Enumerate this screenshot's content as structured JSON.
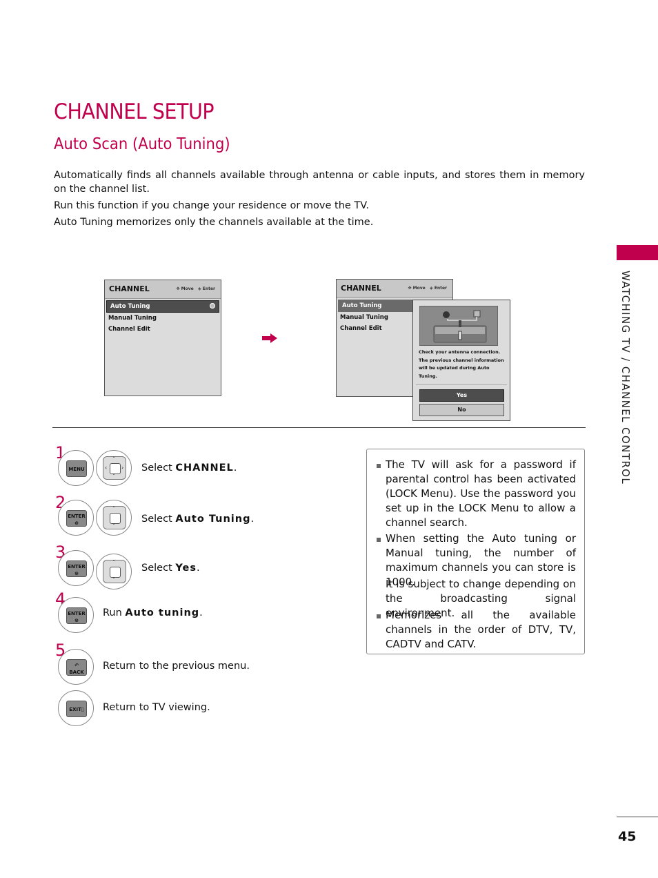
{
  "page": {
    "title": "CHANNEL SETUP",
    "subtitle": "Auto Scan (Auto Tuning)",
    "intro": [
      "Automatically finds all channels available through antenna or cable inputs, and stores them in memory on the channel list.",
      "Run this function if you change your residence or move the TV.",
      "Auto Tuning memorizes only the channels available at the time."
    ],
    "side_label": "WATCHING TV / CHANNEL CONTROL",
    "page_number": "45",
    "accent_color": "#c0004c"
  },
  "osd_left": {
    "title": "CHANNEL",
    "hint_move": "Move",
    "hint_enter": "Enter",
    "items": [
      "Auto Tuning",
      "Manual Tuning",
      "Channel Edit"
    ],
    "selected_index": 0
  },
  "osd_right": {
    "title": "CHANNEL",
    "hint_move": "Move",
    "hint_enter": "Enter",
    "items": [
      "Auto Tuning",
      "Manual Tuning",
      "Channel Edit"
    ],
    "selected_index": 0,
    "popup": {
      "message": "Check your antenna connection. The previous channel information will be updated during Auto Tuning.",
      "yes_label": "Yes",
      "no_label": "No"
    }
  },
  "steps": [
    {
      "num": "1",
      "keys": [
        "MENU",
        "dpad-4way"
      ],
      "prefix": "Select ",
      "bold": "CHANNEL",
      "suffix": "."
    },
    {
      "num": "2",
      "keys": [
        "ENTER",
        "dpad-updown"
      ],
      "prefix": "Select ",
      "bold": "Auto Tuning",
      "suffix": "."
    },
    {
      "num": "3",
      "keys": [
        "ENTER",
        "dpad-updown"
      ],
      "prefix": "Select ",
      "bold": "Yes",
      "suffix": "."
    },
    {
      "num": "4",
      "keys": [
        "ENTER"
      ],
      "prefix": "Run ",
      "bold": "Auto tuning",
      "suffix": "."
    },
    {
      "num": "5",
      "keys": [
        "BACK"
      ],
      "text": "Return to the previous menu."
    },
    {
      "num": "",
      "keys": [
        "EXIT"
      ],
      "text": "Return to TV viewing."
    }
  ],
  "key_labels": {
    "menu": "MENU",
    "enter": "ENTER",
    "back": "BACK",
    "exit": "EXIT"
  },
  "notes": [
    "The TV will ask for a password if parental control has been activated (LOCK Menu). Use the password you set up in the LOCK Menu to allow a channel search.",
    "When setting the Auto tuning or Manual tuning, the number of maximum channels you can store is 1000.",
    "It is subject to change depending on the broadcasting signal environment.",
    "Memorizes all the available channels in the order of DTV, TV, CADTV and CATV."
  ]
}
